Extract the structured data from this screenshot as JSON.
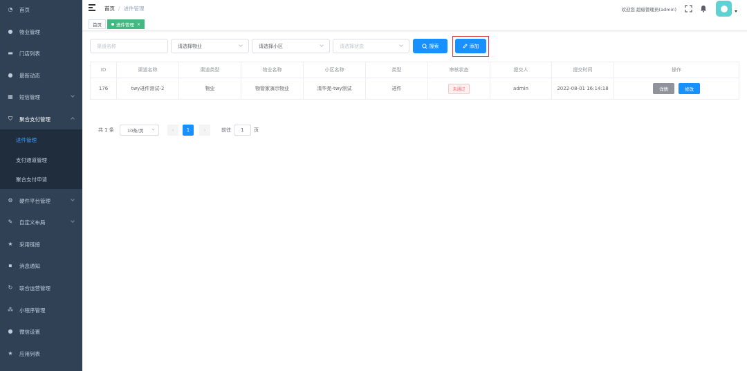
{
  "sidebar": {
    "items": [
      {
        "label": "首页",
        "icon": "dashboard-icon",
        "expandable": false
      },
      {
        "label": "物业管理",
        "icon": "user-icon",
        "expandable": false
      },
      {
        "label": "门店列表",
        "icon": "store-icon",
        "expandable": false
      },
      {
        "label": "最新动态",
        "icon": "chat-icon",
        "expandable": false
      },
      {
        "label": "短信管理",
        "icon": "grid-icon",
        "expandable": true
      },
      {
        "label": "聚合支付管理",
        "icon": "shield-icon",
        "expandable": true,
        "open": true
      },
      {
        "label": "硬件平台管理",
        "icon": "settings-icon",
        "expandable": true
      },
      {
        "label": "自定义布局",
        "icon": "pencil-icon",
        "expandable": true
      },
      {
        "label": "采用链接",
        "icon": "star-icon",
        "expandable": false
      },
      {
        "label": "消息通知",
        "icon": "message-icon",
        "expandable": false
      },
      {
        "label": "联合运营管理",
        "icon": "sync-icon",
        "expandable": false
      },
      {
        "label": "小程序管理",
        "icon": "network-icon",
        "expandable": false
      },
      {
        "label": "微信设置",
        "icon": "wechat-icon",
        "expandable": false
      },
      {
        "label": "应用列表",
        "icon": "star-icon",
        "expandable": false
      }
    ],
    "submenu": [
      {
        "label": "进件管理",
        "active": true
      },
      {
        "label": "支付通道管理",
        "active": false
      },
      {
        "label": "聚合支付申请",
        "active": false
      }
    ]
  },
  "navbar": {
    "breadcrumb_home": "首页",
    "breadcrumb_sep": "/",
    "breadcrumb_current": "进件管理",
    "welcome": "欢迎您 超级管理员(admin)",
    "fullscreen_icon": "fullscreen-icon",
    "bell_icon": "bell-icon"
  },
  "tags": [
    {
      "label": "首页",
      "active": false
    },
    {
      "label": "进件管理",
      "active": true
    }
  ],
  "filters": {
    "channel_placeholder": "渠道名称",
    "property_placeholder": "请选择物业",
    "community_placeholder": "请选择小区",
    "status_placeholder": "请选择状态",
    "search_label": "搜索",
    "add_label": "添加"
  },
  "table": {
    "columns": [
      "ID",
      "渠道名称",
      "渠道类型",
      "物业名称",
      "小区名称",
      "类型",
      "审核状态",
      "提交人",
      "提交时间",
      "操作"
    ],
    "rows": [
      {
        "id": "176",
        "channel_name": "twy进件测试-2",
        "channel_type": "物业",
        "property_name": "物管家演示物业",
        "community_name": "清华苑-twy测试",
        "type": "进件",
        "status": "未通过",
        "submitter": "admin",
        "submit_time": "2022-08-01 16:14:18",
        "detail_label": "详情",
        "edit_label": "修改"
      }
    ]
  },
  "pagination": {
    "total_text": "共 1 条",
    "page_size": "10条/页",
    "prev_icon": "‹",
    "current_page": "1",
    "next_icon": "›",
    "goto_label": "前往",
    "goto_value": "1",
    "page_unit": "页"
  },
  "colors": {
    "sidebar_bg": "#304156",
    "submenu_bg": "#1f2d3d",
    "primary": "#1890ff",
    "tag_active": "#42b983",
    "danger": "#f56c6c",
    "highlight_border": "#d9363e"
  }
}
